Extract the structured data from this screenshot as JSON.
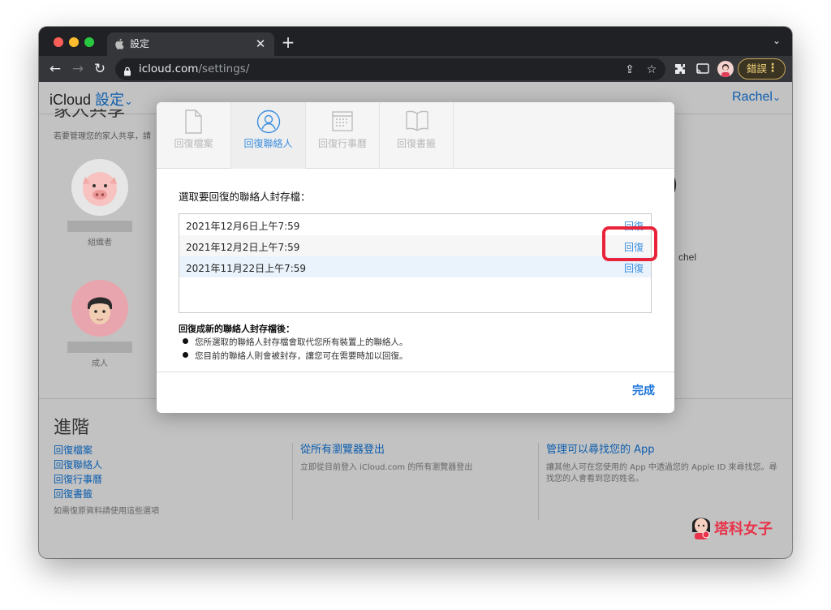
{
  "browser": {
    "tab_title": "設定",
    "url_host": "icloud.com",
    "url_path": "/settings/",
    "error_button_label": "錯誤"
  },
  "header": {
    "brand": "iCloud",
    "section": "設定",
    "chevron": "⌄",
    "user": "Rachel"
  },
  "family": {
    "title": "家人共享",
    "description": "若要管理您的家人共享，請",
    "members": [
      {
        "role": "組織者"
      },
      {
        "role": "成人"
      }
    ],
    "partial_name": "chel"
  },
  "advanced": {
    "title": "進階",
    "links": [
      "回復檔案",
      "回復聯絡人",
      "回復行事曆",
      "回復書籤"
    ],
    "links_note": "如需復原資料請使用這些選項",
    "signout_title": "從所有瀏覽器登出",
    "signout_desc": "立即從目前登入 iCloud.com 的所有瀏覽器登出",
    "findmy_title": "管理可以尋找您的 App",
    "findmy_desc": "讓其他人可在您使用的 App 中透過您的 Apple ID 來尋找您。尋找您的人會看到您的姓名。"
  },
  "modal": {
    "tabs": [
      {
        "label": "回復檔案",
        "icon": "document-icon",
        "active": false
      },
      {
        "label": "回復聯絡人",
        "icon": "contact-icon",
        "active": true
      },
      {
        "label": "回復行事曆",
        "icon": "calendar-icon",
        "active": false
      },
      {
        "label": "回復書籤",
        "icon": "book-icon",
        "active": false
      }
    ],
    "prompt": "選取要回復的聯絡人封存檔：",
    "archives": [
      {
        "date": "2021年12月6日上午7:59",
        "action": "回復"
      },
      {
        "date": "2021年12月2日上午7:59",
        "action": "回復"
      },
      {
        "date": "2021年11月22日上午7:59",
        "action": "回復"
      }
    ],
    "info_title": "回復成新的聯絡人封存檔後：",
    "bullets": [
      "您所選取的聯絡人封存檔會取代您所有裝置上的聯絡人。",
      "您目前的聯絡人則會被封存，讓您可在需要時加以回復。"
    ],
    "done_label": "完成"
  },
  "watermark": "塔科女子",
  "colors": {
    "link": "#0c5dae",
    "accent": "#3a8fe0",
    "highlight": "#e8233a"
  }
}
